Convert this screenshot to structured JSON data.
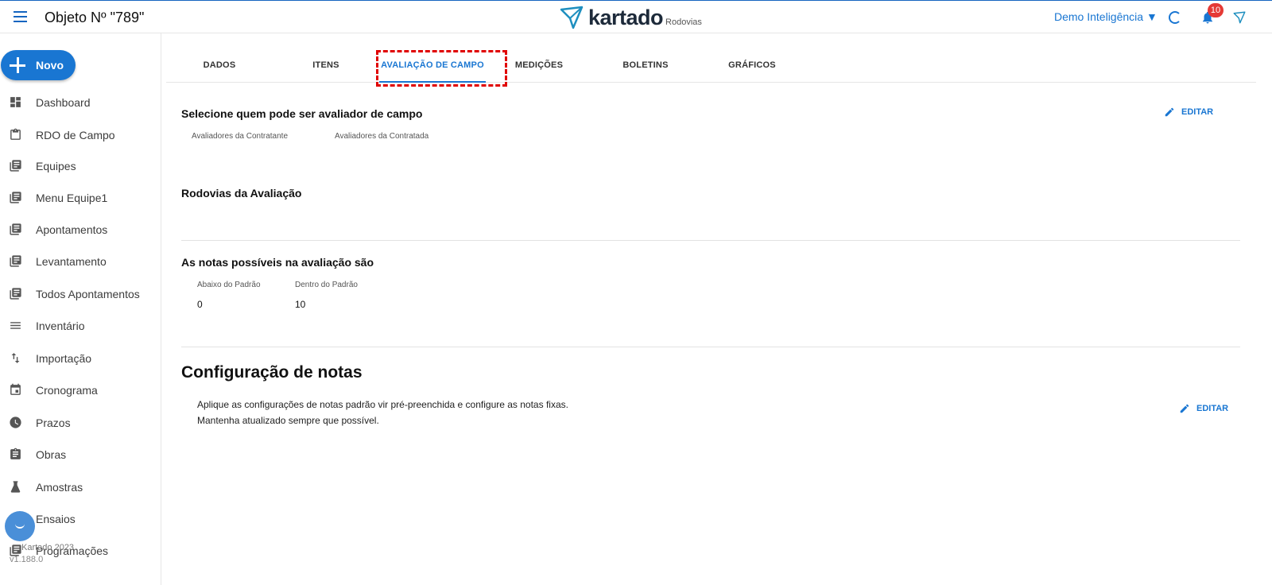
{
  "header": {
    "title": "Objeto Nº \"789\"",
    "logo_name": "kartado",
    "logo_sub": "Rodovias",
    "user_menu": "Demo Inteligência ▼",
    "notification_count": "10",
    "colors": {
      "accent": "#1976d2",
      "badge": "#e53935"
    }
  },
  "sidebar": {
    "new_button": "Novo",
    "items": [
      {
        "label": "Dashboard",
        "icon": "dashboard-icon"
      },
      {
        "label": "RDO de Campo",
        "icon": "clipboard-icon"
      },
      {
        "label": "Equipes",
        "icon": "library-icon"
      },
      {
        "label": "Menu Equipe1",
        "icon": "library-icon"
      },
      {
        "label": "Apontamentos",
        "icon": "library-icon"
      },
      {
        "label": "Levantamento",
        "icon": "library-icon"
      },
      {
        "label": "Todos Apontamentos",
        "icon": "library-icon"
      },
      {
        "label": "Inventário",
        "icon": "list-icon"
      },
      {
        "label": "Importação",
        "icon": "import-export-icon"
      },
      {
        "label": "Cronograma",
        "icon": "calendar-icon"
      },
      {
        "label": "Prazos",
        "icon": "clock-icon"
      },
      {
        "label": "Obras",
        "icon": "assignment-icon"
      },
      {
        "label": "Amostras",
        "icon": "flask-icon"
      },
      {
        "label": "Ensaios",
        "icon": "library-icon"
      },
      {
        "label": "Programações",
        "icon": "library-icon"
      }
    ],
    "footer": "Kartado 2023",
    "version": "v1.188.0"
  },
  "tabs": [
    {
      "label": "DADOS"
    },
    {
      "label": "ITENS"
    },
    {
      "label": "AVALIAÇÃO DE CAMPO"
    },
    {
      "label": "MEDIÇÕES"
    },
    {
      "label": "BOLETINS"
    },
    {
      "label": "GRÁFICOS"
    }
  ],
  "main": {
    "evaluators": {
      "title": "Selecione quem pode ser avaliador de campo",
      "contractor_label": "Avaliadores da Contratante",
      "contracted_label": "Avaliadores da Contratada",
      "edit_label": "EDITAR"
    },
    "highways": {
      "title": "Rodovias da Avaliação"
    },
    "grades": {
      "title": "As notas possíveis na avaliação são",
      "below_label": "Abaixo do Padrão",
      "below_value": "0",
      "within_label": "Dentro do Padrão",
      "within_value": "10"
    },
    "grade_config": {
      "title": "Configuração de notas",
      "line1": "Aplique as configurações de notas padrão vir pré-preenchida e configure as notas fixas.",
      "line2": "Mantenha atualizado sempre que possível.",
      "edit_label": "EDITAR"
    }
  }
}
